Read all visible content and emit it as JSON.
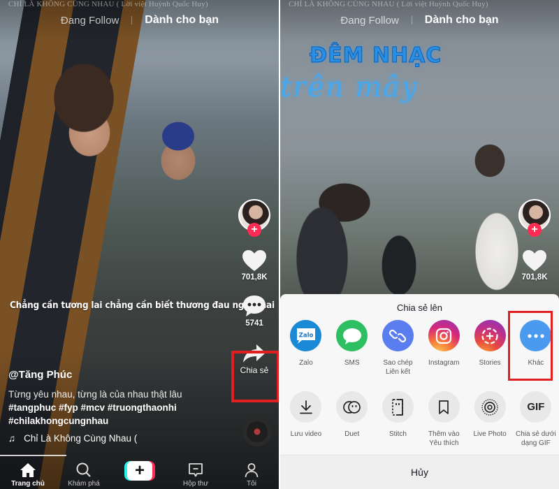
{
  "left_screen": {
    "lyric_watermark": "CHỈ LÀ KHÔNG CÙNG NHAU ( Lời việt Huỳnh Quốc Huy)",
    "feed_tabs": [
      {
        "label": "Đang Follow",
        "active": false
      },
      {
        "label": "Dành cho bạn",
        "active": true
      }
    ],
    "caption_overlay": "Chẳng cần tương lai chẳng cần biết thương đau ngày mai",
    "rail": {
      "likes": "701,8K",
      "comments": "5741",
      "share_label": "Chia sẻ"
    },
    "post": {
      "username": "@Tăng Phúc",
      "description": "Từng yêu nhau, từng là của nhau thật lâu",
      "hashtags_line1": "#tangphuc #fyp #mcv #truongthaonhi",
      "hashtags_line2": "#chilakhongcungnhau",
      "music": "Chỉ Là Không Cùng Nhau ("
    },
    "bottom_nav": [
      {
        "label": "Trang chủ",
        "icon": "home-icon",
        "active": true
      },
      {
        "label": "Khám phá",
        "icon": "search-icon",
        "active": false
      },
      {
        "label": "",
        "icon": "create-plus-icon",
        "active": false
      },
      {
        "label": "Hộp thư",
        "icon": "inbox-icon",
        "active": false
      },
      {
        "label": "Tôi",
        "icon": "profile-icon",
        "active": false
      }
    ]
  },
  "right_screen": {
    "lyric_watermark": "CHỈ LÀ KHÔNG CÙNG NHAU ( Lời việt Huỳnh Quốc Huy)",
    "feed_tabs": [
      {
        "label": "Đang Follow",
        "active": false
      },
      {
        "label": "Dành cho bạn",
        "active": true
      }
    ],
    "event_title_line1": "ĐÊM NHẠC",
    "event_title_line2": "trên mây",
    "rail": {
      "likes": "701,8K"
    },
    "share_sheet": {
      "title": "Chia sẻ lên",
      "row1": [
        {
          "label": "Zalo",
          "icon": "zalo-icon",
          "color": "#1a8ad6"
        },
        {
          "label": "SMS",
          "icon": "sms-icon",
          "color": "#2dbf62"
        },
        {
          "label": "Sao chép Liên kết",
          "icon": "link-icon",
          "color": "#5a7ef0"
        },
        {
          "label": "Instagram",
          "icon": "instagram-icon",
          "color": "#d6287a"
        },
        {
          "label": "Stories",
          "icon": "stories-icon",
          "color": "#c02f8a"
        },
        {
          "label": "Khác",
          "icon": "more-icon",
          "color": "#4a9bf0"
        }
      ],
      "row2": [
        {
          "label": "Lưu video",
          "icon": "download-icon"
        },
        {
          "label": "Duet",
          "icon": "duet-icon"
        },
        {
          "label": "Stitch",
          "icon": "stitch-icon"
        },
        {
          "label": "Thêm vào Yêu thích",
          "icon": "bookmark-icon"
        },
        {
          "label": "Live Photo",
          "icon": "live-photo-icon"
        },
        {
          "label": "Chia sẻ dưới dạng GIF",
          "icon": "gif-icon",
          "glyph": "GIF"
        }
      ],
      "cancel_label": "Hủy"
    }
  },
  "highlight_color": "#e02020",
  "accent_color": "#fe2c55"
}
